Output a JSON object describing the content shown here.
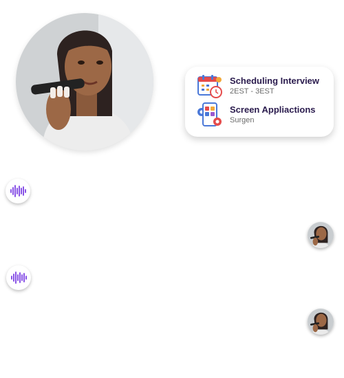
{
  "tasks": [
    {
      "title": "Scheduling Interview",
      "subtitle": "2EST - 3EST",
      "icon": "calendar-clock-icon"
    },
    {
      "title": "Screen Appliactions",
      "subtitle": "Surgen",
      "icon": "phone-gear-icon"
    }
  ],
  "icons": {
    "voice": "audio-waveform-icon",
    "hero": "woman-on-phone-photo",
    "avatar": "user-avatar"
  },
  "colors": {
    "accent": "#7b3fe4",
    "title": "#2a1b4d"
  }
}
